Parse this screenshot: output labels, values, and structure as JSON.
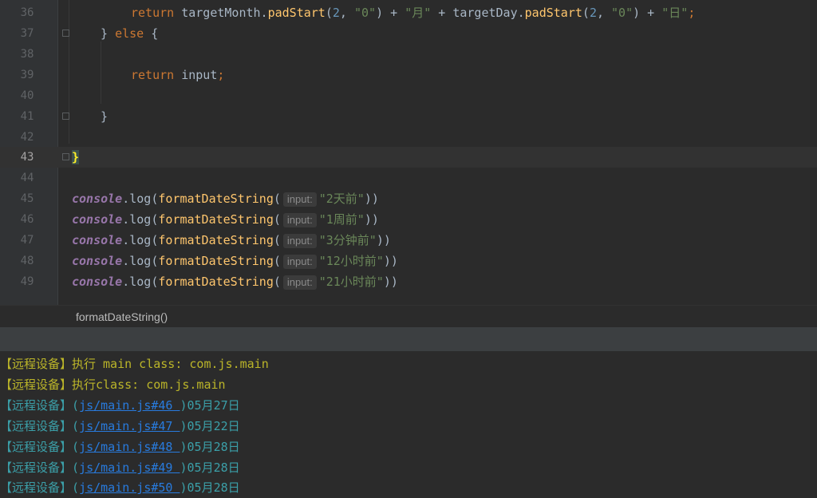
{
  "editor": {
    "lines": [
      {
        "num": "36"
      },
      {
        "num": "37"
      },
      {
        "num": "38"
      },
      {
        "num": "39"
      },
      {
        "num": "40"
      },
      {
        "num": "41"
      },
      {
        "num": "42"
      },
      {
        "num": "43"
      },
      {
        "num": "44"
      },
      {
        "num": "45"
      },
      {
        "num": "46"
      },
      {
        "num": "47"
      },
      {
        "num": "48"
      },
      {
        "num": "49"
      }
    ],
    "code": {
      "l36": {
        "kw_return": "return",
        "t1": " targetMonth.",
        "m1": "padStart",
        "t2": "(",
        "n1": "2",
        "t3": ", ",
        "s1": "\"0\"",
        "t4": ") + ",
        "s2": "\"月\"",
        "t5": " + targetDay.",
        "m2": "padStart",
        "t6": "(",
        "n2": "2",
        "t7": ", ",
        "s3": "\"0\"",
        "t8": ") + ",
        "s4": "\"日\"",
        "t9": ";"
      },
      "l37": {
        "t1": "} ",
        "kw_else": "else",
        "t2": " {"
      },
      "l39": {
        "kw_return": "return",
        "t1": " input",
        "t2": ";"
      },
      "l41": {
        "t1": "}"
      },
      "l43": {
        "t1": "}"
      },
      "calls": [
        {
          "obj": "console",
          "t1": ".log(",
          "fn": "formatDateString",
          "t2": "(",
          "hint": "input:",
          "arg": "\"2天前\"",
          "t3": "))"
        },
        {
          "obj": "console",
          "t1": ".log(",
          "fn": "formatDateString",
          "t2": "(",
          "hint": "input:",
          "arg": "\"1周前\"",
          "t3": "))"
        },
        {
          "obj": "console",
          "t1": ".log(",
          "fn": "formatDateString",
          "t2": "(",
          "hint": "input:",
          "arg": "\"3分钟前\"",
          "t3": "))"
        },
        {
          "obj": "console",
          "t1": ".log(",
          "fn": "formatDateString",
          "t2": "(",
          "hint": "input:",
          "arg": "\"12小时前\"",
          "t3": "))"
        },
        {
          "obj": "console",
          "t1": ".log(",
          "fn": "formatDateString",
          "t2": "(",
          "hint": "input:",
          "arg": "\"21小时前\"",
          "t3": "))"
        }
      ]
    }
  },
  "breadcrumb": {
    "label": "formatDateString()"
  },
  "console": {
    "info_lines": [
      "【远程设备】执行 main class: com.js.main",
      "【远程设备】执行class: com.js.main"
    ],
    "log_lines": [
      {
        "prefix": "【远程设备】(",
        "link": "js/main.js#46 ",
        "suffix": ")05月27日"
      },
      {
        "prefix": "【远程设备】(",
        "link": "js/main.js#47 ",
        "suffix": ")05月22日"
      },
      {
        "prefix": "【远程设备】(",
        "link": "js/main.js#48 ",
        "suffix": ")05月28日"
      },
      {
        "prefix": "【远程设备】(",
        "link": "js/main.js#49 ",
        "suffix": ")05月28日"
      },
      {
        "prefix": "【远程设备】(",
        "link": "js/main.js#50 ",
        "suffix": ")05月28日"
      }
    ]
  }
}
